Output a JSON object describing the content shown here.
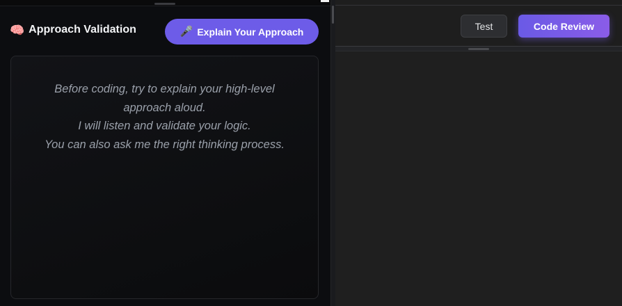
{
  "approach_panel": {
    "icon": "brain-icon",
    "title": "Approach Validation",
    "explain_button": {
      "icon": "microphone-icon",
      "label": "Explain Your Approach"
    },
    "message_lines": [
      "Before coding, try to explain your high-level",
      "approach aloud.",
      "I will listen and validate your logic.",
      "You can also ask me the right thinking process."
    ]
  },
  "editor_toolbar": {
    "test_label": "Test",
    "review_label": "Code Review"
  },
  "colors": {
    "accent": "#6d5ce8",
    "left_background": "#0c0d10",
    "right_background": "#1e1e1e",
    "message_text": "#9aa0aa"
  }
}
